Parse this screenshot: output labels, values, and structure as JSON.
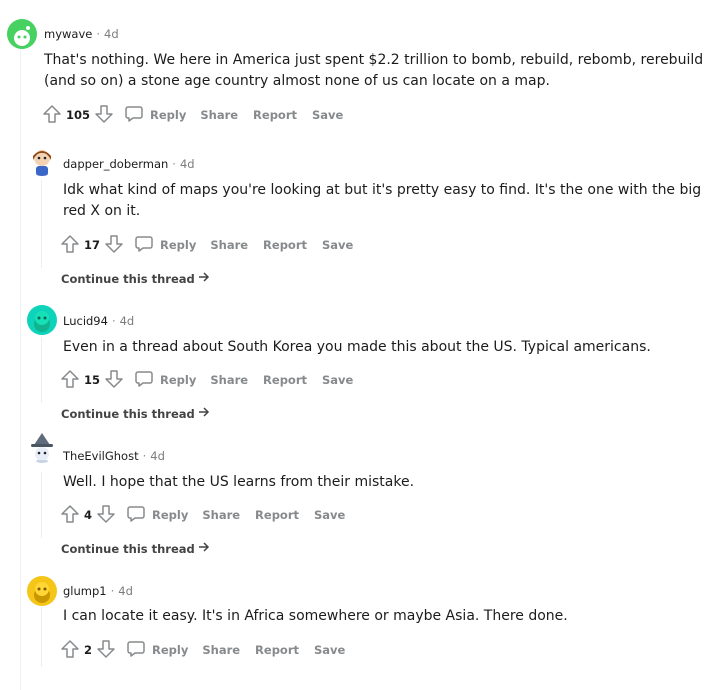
{
  "comments": [
    {
      "author": "mywave",
      "time": "4d",
      "body": "That's nothing. We here in America just spent $2.2 trillion to bomb, rebuild, rebomb, rerebuild (and so on) a stone age country almost none of us can locate on a map.",
      "votes": "105",
      "avatar_color": "#46d160"
    },
    {
      "author": "dapper_doberman",
      "time": "4d",
      "body": "Idk what kind of maps you're looking at but it's pretty easy to find. It's the one with the big red X on it.",
      "votes": "17",
      "avatar_color": "#a0522d"
    },
    {
      "author": "Lucid94",
      "time": "4d",
      "body": "Even in a thread about South Korea you made this about the US. Typical americans.",
      "votes": "15",
      "avatar_color": "#0dd3bb"
    },
    {
      "author": "TheEvilGhost",
      "time": "4d",
      "body": "Well. I hope that the US learns from their mistake.",
      "votes": "4",
      "avatar_color": "#5f6b7a"
    },
    {
      "author": "glump1",
      "time": "4d",
      "body": "I can locate it easy. It's in Africa somewhere or maybe Asia. There done.",
      "votes": "2",
      "avatar_color": "#f5c518"
    }
  ],
  "actions": {
    "reply": "Reply",
    "share": "Share",
    "report": "Report",
    "save": "Save"
  },
  "continue_label": "Continue this thread",
  "icons": {
    "upvote": "upvote-icon",
    "downvote": "downvote-icon",
    "reply": "speech-bubble-icon",
    "continue": "arrow-right-icon"
  }
}
